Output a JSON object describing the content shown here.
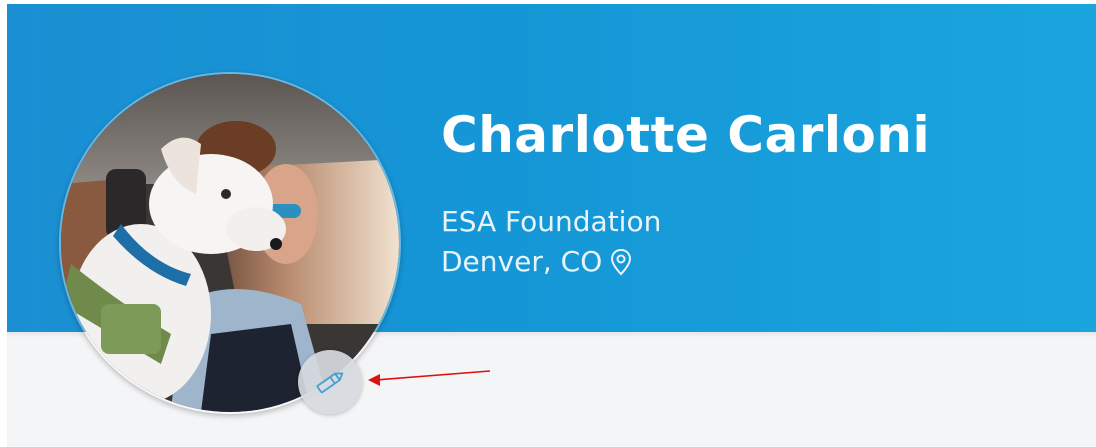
{
  "profile": {
    "name": "Charlotte Carloni",
    "organization": "ESA Foundation",
    "location": "Denver, CO"
  },
  "icons": {
    "location": "map-pin-icon",
    "edit_photo": "pencil-icon"
  },
  "colors": {
    "header_bg": "#1596d6",
    "footer_bg": "#f4f5f7",
    "text_primary": "#ffffff",
    "annotation_arrow": "#e01010"
  }
}
